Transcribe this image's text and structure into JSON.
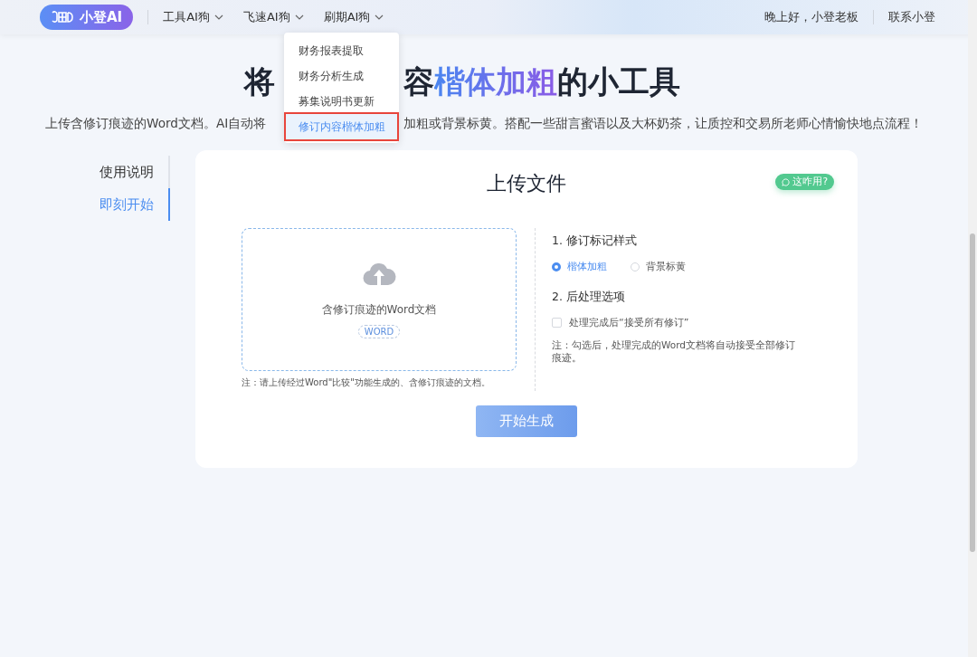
{
  "header": {
    "logo": "小登AI",
    "nav": [
      {
        "label": "工具AI狗"
      },
      {
        "label": "飞速AI狗"
      },
      {
        "label": "刷期AI狗"
      }
    ],
    "greeting": "晚上好，小登老板",
    "contact": "联系小登"
  },
  "dropdown": {
    "items": [
      {
        "label": "财务报表提取",
        "selected": false
      },
      {
        "label": "财务分析生成",
        "selected": false
      },
      {
        "label": "募集说明书更新",
        "selected": false
      },
      {
        "label": "修订内容楷体加粗",
        "selected": true
      }
    ]
  },
  "hero": {
    "title_start": "将",
    "title_mid": "容",
    "title_highlight": "楷体加粗",
    "title_end": "的小工具",
    "subtitle_left": "上传含修订痕迹的Word文档。AI自动将",
    "subtitle_right": "加粗或背景标黄。搭配一些甜言蜜语以及大杯奶茶，让质控和交易所老师心情愉快地点流程！"
  },
  "side_nav": [
    {
      "label": "使用说明",
      "selected": false
    },
    {
      "label": "即刻开始",
      "selected": true
    }
  ],
  "upload": {
    "title": "上传文件",
    "help_badge": "这咋用?",
    "dropzone_label": "含修订痕迹的Word文档",
    "file_type": "WORD",
    "note": "注：请上传经过Word\"比较\"功能生成的、含修订痕迹的文档。"
  },
  "options": {
    "style_heading": "1. 修订标记样式",
    "styles": [
      {
        "label": "楷体加粗",
        "selected": true
      },
      {
        "label": "背景标黄",
        "selected": false
      }
    ],
    "post_heading": "2. 后处理选项",
    "accept_all": {
      "label": "处理完成后“接受所有修订”",
      "checked": false
    },
    "post_note": "注：勾选后，处理完成的Word文档将自动接受全部修订痕迹。"
  },
  "submit": "开始生成"
}
